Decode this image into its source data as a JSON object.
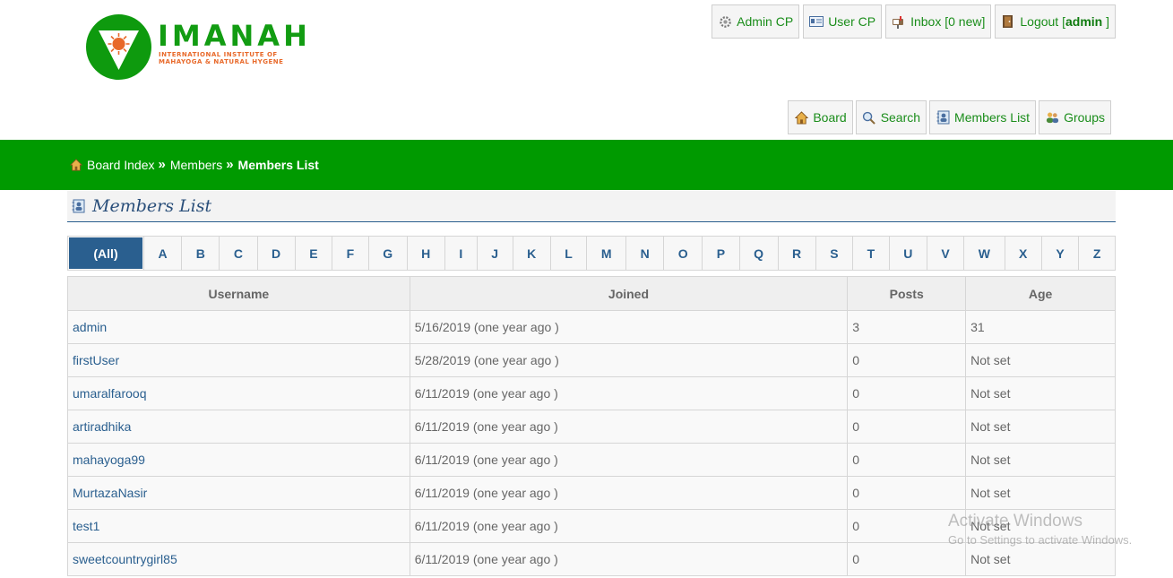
{
  "logo": {
    "name": "IMANAH",
    "tagline": "INTERNATIONAL INSTITUTE OF MAHAYOGA & NATURAL HYGENE"
  },
  "top_nav": {
    "admin_cp": "Admin CP",
    "user_cp": "User CP",
    "inbox": "Inbox [0 new]",
    "logout_prefix": "Logout [",
    "logout_user": "admin",
    "logout_suffix": " ]"
  },
  "sub_nav": {
    "board": "Board",
    "search": "Search",
    "members_list": "Members List",
    "groups": "Groups"
  },
  "breadcrumb": {
    "board_index": "Board Index",
    "members": "Members",
    "current": "Members List",
    "separator": "»"
  },
  "page_title": "Members List",
  "alphabet": [
    "(All)",
    "A",
    "B",
    "C",
    "D",
    "E",
    "F",
    "G",
    "H",
    "I",
    "J",
    "K",
    "L",
    "M",
    "N",
    "O",
    "P",
    "Q",
    "R",
    "S",
    "T",
    "U",
    "V",
    "W",
    "X",
    "Y",
    "Z"
  ],
  "table": {
    "headers": [
      "Username",
      "Joined",
      "Posts",
      "Age"
    ],
    "rows": [
      [
        "admin",
        "5/16/2019 (one year ago )",
        "3",
        "31"
      ],
      [
        "firstUser",
        "5/28/2019 (one year ago )",
        "0",
        "Not set"
      ],
      [
        "umaralfarooq",
        "6/11/2019 (one year ago )",
        "0",
        "Not set"
      ],
      [
        "artiradhika",
        "6/11/2019 (one year ago )",
        "0",
        "Not set"
      ],
      [
        "mahayoga99",
        "6/11/2019 (one year ago )",
        "0",
        "Not set"
      ],
      [
        "MurtazaNasir",
        "6/11/2019 (one year ago )",
        "0",
        "Not set"
      ],
      [
        "test1",
        "6/11/2019 (one year ago )",
        "0",
        "Not set"
      ],
      [
        "sweetcountrygirl85",
        "6/11/2019 (one year ago )",
        "0",
        "Not set"
      ]
    ]
  },
  "watermark": {
    "title": "Activate Windows",
    "subtitle": "Go to Settings to activate Windows."
  },
  "colors": {
    "brand_green": "#009a00",
    "link_blue": "#2a5f8f",
    "logo_orange": "#e8692a"
  }
}
